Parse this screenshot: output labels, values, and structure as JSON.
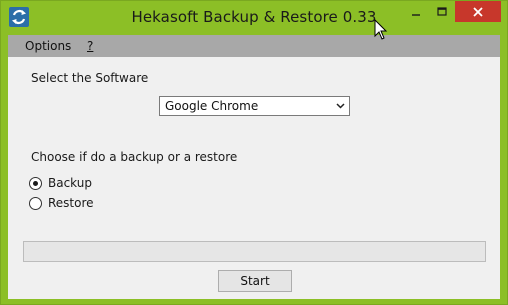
{
  "window": {
    "title": "Hekasoft Backup & Restore 0.33",
    "accent_color": "#8cbf26",
    "close_color": "#c7372b"
  },
  "titlebar": {
    "icons": {
      "app": "app-sync-icon",
      "minimize": "minimize-icon",
      "maximize": "maximize-icon",
      "close": "close-icon"
    }
  },
  "menubar": {
    "items": [
      {
        "label": "Options"
      },
      {
        "label": "?"
      }
    ]
  },
  "form": {
    "software_label": "Select the Software",
    "software_selected": "Google Chrome",
    "mode_label": "Choose if do a backup or a restore",
    "options": [
      {
        "label": "Backup",
        "checked": true
      },
      {
        "label": "Restore",
        "checked": false
      }
    ],
    "progress": 0,
    "start_label": "Start"
  }
}
